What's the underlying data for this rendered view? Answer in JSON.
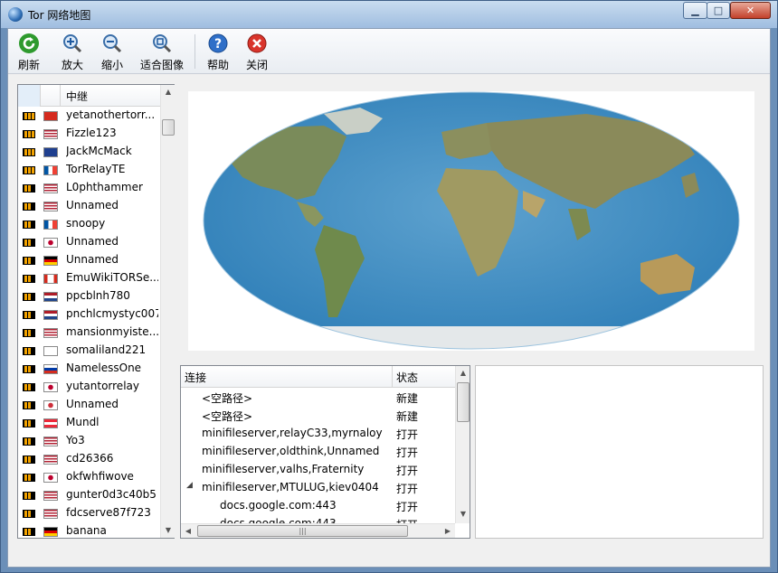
{
  "window": {
    "title": "Tor 网络地图",
    "min_symbol": "▁",
    "max_symbol": "□",
    "close_symbol": "✕"
  },
  "toolbar": {
    "refresh_label": "刷新",
    "zoom_in_label": "放大",
    "zoom_out_label": "缩小",
    "fit_label": "适合图像",
    "help_label": "帮助",
    "close_label": "关闭"
  },
  "relay_list": {
    "header": "中继",
    "rows": [
      {
        "name": "yetanothertorr...",
        "flag": "ch",
        "bw": 3
      },
      {
        "name": "Fizzle123",
        "flag": "us",
        "bw": 3
      },
      {
        "name": "JackMcMack",
        "flag": "gb",
        "bw": 3
      },
      {
        "name": "TorRelayTE",
        "flag": "fr",
        "bw": 3
      },
      {
        "name": "L0phthammer",
        "flag": "us",
        "bw": 2
      },
      {
        "name": "Unnamed",
        "flag": "us",
        "bw": 2
      },
      {
        "name": "snoopy",
        "flag": "fr",
        "bw": 2
      },
      {
        "name": "Unnamed",
        "flag": "jp",
        "bw": 2
      },
      {
        "name": "Unnamed",
        "flag": "de",
        "bw": 2
      },
      {
        "name": "EmuWikiTORSe...",
        "flag": "ca",
        "bw": 2
      },
      {
        "name": "ppcblnh780",
        "flag": "nl",
        "bw": 2
      },
      {
        "name": "pnchlcmystyc007",
        "flag": "nl",
        "bw": 2
      },
      {
        "name": "mansionmyiste...",
        "flag": "us",
        "bw": 2
      },
      {
        "name": "somaliland221",
        "flag": "fi",
        "bw": 2
      },
      {
        "name": "NamelessOne",
        "flag": "ru",
        "bw": 2
      },
      {
        "name": "yutantorrelay",
        "flag": "jp",
        "bw": 2
      },
      {
        "name": "Unnamed",
        "flag": "kr",
        "bw": 2
      },
      {
        "name": "Mundl",
        "flag": "at",
        "bw": 2
      },
      {
        "name": "Yo3",
        "flag": "us",
        "bw": 2
      },
      {
        "name": "cd26366",
        "flag": "us",
        "bw": 2
      },
      {
        "name": "okfwhfiwove",
        "flag": "jp",
        "bw": 2
      },
      {
        "name": "gunter0d3c40b5",
        "flag": "us",
        "bw": 2
      },
      {
        "name": "fdcserve87f723",
        "flag": "us",
        "bw": 2
      },
      {
        "name": "banana",
        "flag": "de",
        "bw": 2
      }
    ]
  },
  "connections": {
    "col_connection": "连接",
    "col_status": "状态",
    "rows": [
      {
        "name": "<空路径>",
        "status": "新建",
        "level": 1,
        "expander": ""
      },
      {
        "name": "<空路径>",
        "status": "新建",
        "level": 1,
        "expander": ""
      },
      {
        "name": "minifileserver,relayC33,myrnaloy",
        "status": "打开",
        "level": 1,
        "expander": ""
      },
      {
        "name": "minifileserver,oldthink,Unnamed",
        "status": "打开",
        "level": 1,
        "expander": ""
      },
      {
        "name": "minifileserver,valhs,Fraternity",
        "status": "打开",
        "level": 1,
        "expander": ""
      },
      {
        "name": "minifileserver,MTULUG,kiev0404",
        "status": "打开",
        "level": 1,
        "expander": "◢"
      },
      {
        "name": "docs.google.com:443",
        "status": "打开",
        "level": 2,
        "expander": ""
      },
      {
        "name": "docs.google.com:443",
        "status": "打开",
        "level": 2,
        "expander": ""
      }
    ],
    "scroll_grip": "|||"
  }
}
